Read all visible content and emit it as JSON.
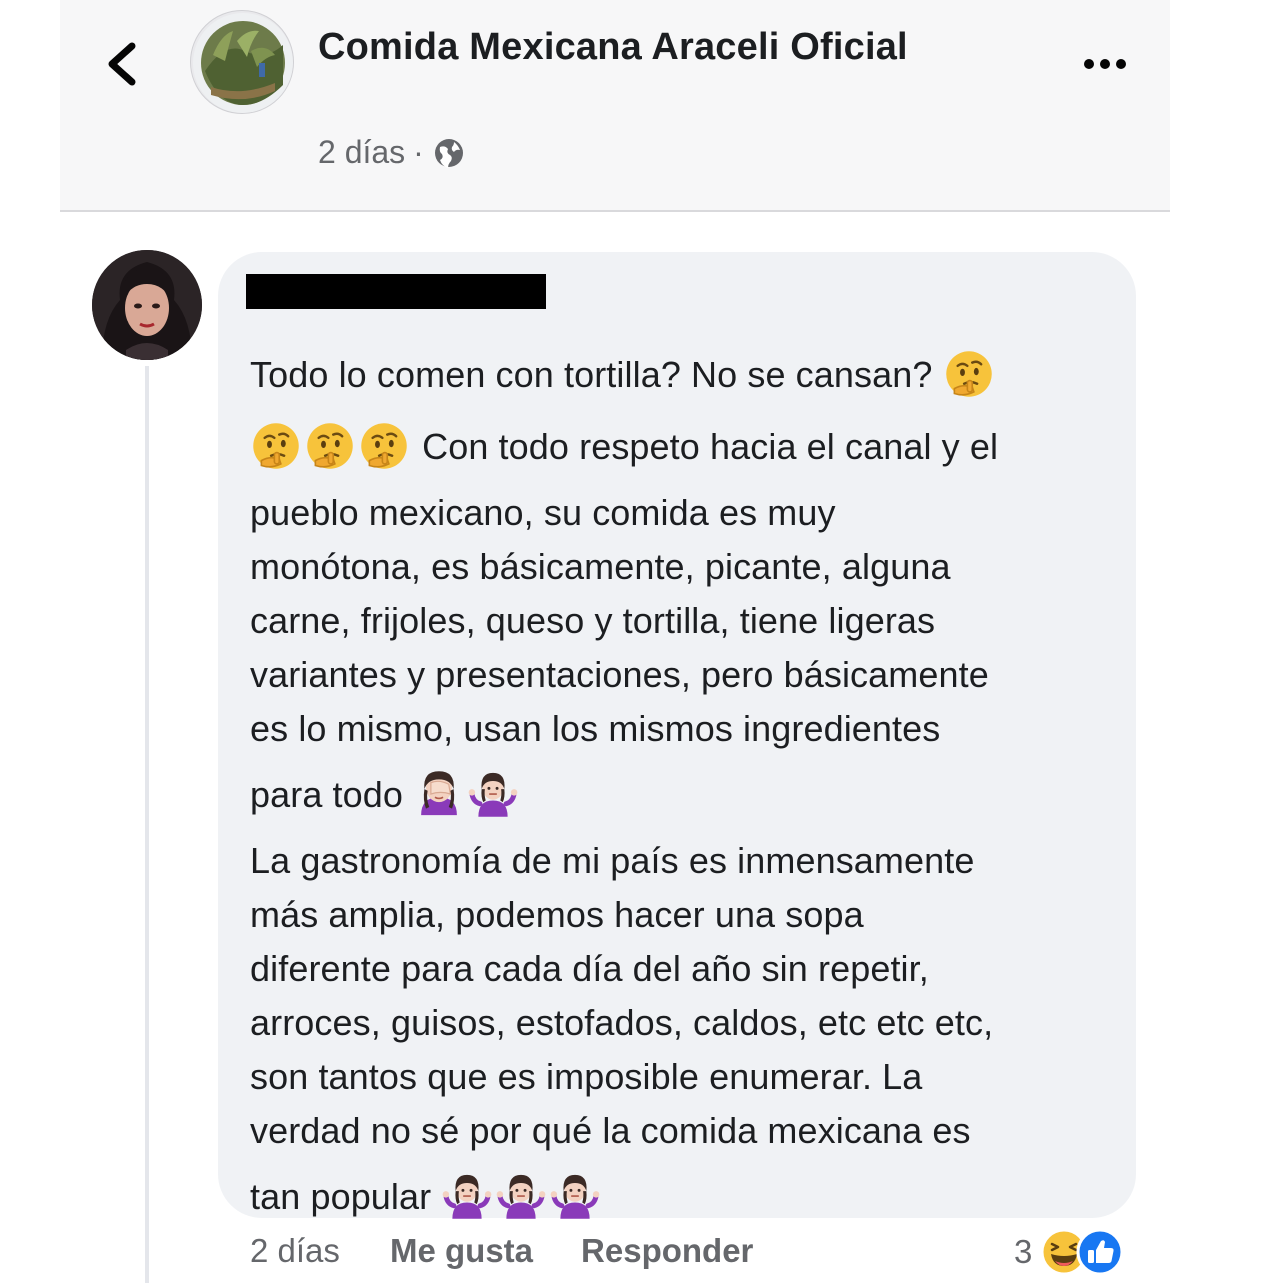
{
  "header": {
    "page_name": "Comida Mexicana Araceli Oficial",
    "post_time": "2 días",
    "separator": "·",
    "privacy_icon": "globe-icon",
    "back_icon": "chevron-left-icon",
    "more_icon": "more-horizontal-icon"
  },
  "comment": {
    "lines": [
      "Todo lo comen con tortilla? No se cansan?",
      "Con todo respeto hacia el canal y el",
      "pueblo mexicano, su comida es muy",
      "monótona, es básicamente, picante, alguna",
      "carne, frijoles, queso y tortilla, tiene ligeras",
      "variantes y presentaciones, pero básicamente",
      "es lo mismo, usan los mismos ingredientes",
      "para todo",
      "La gastronomía de mi país es inmensamente",
      "más amplia, podemos hacer una sopa",
      "diferente para cada día del año sin repetir,",
      "arroces, guisos, estofados, caldos, etc etc etc,",
      "son tantos que es imposible enumerar. La",
      "verdad no sé por qué la comida mexicana es",
      "tan popular"
    ],
    "emojis": {
      "thinking": "thinking-face-emoji",
      "facepalm": "woman-facepalming-emoji",
      "shrug": "woman-shrugging-emoji"
    }
  },
  "actions": {
    "time": "2 días",
    "like_label": "Me gusta",
    "reply_label": "Responder",
    "reaction_count": "3",
    "reaction_icons": [
      "haha-reaction-icon",
      "like-reaction-icon"
    ]
  },
  "colors": {
    "like_blue": "#1877f2",
    "emoji_yellow": "#f7c33b",
    "emoji_purple": "#8a3ab9",
    "meta_gray": "#65676b",
    "bubble_bg": "#f0f2f5"
  }
}
